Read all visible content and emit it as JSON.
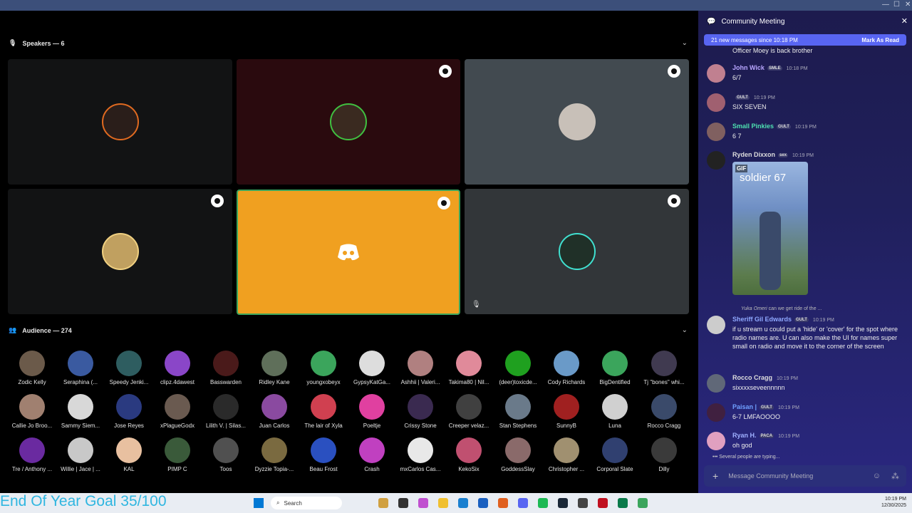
{
  "stage": {
    "speakers_label": "Speakers — 6",
    "audience_label": "Audience — 274"
  },
  "audience": [
    {
      "name": "Zodic Kelly",
      "color": "#6b5a4a"
    },
    {
      "name": "Seraphina (...",
      "color": "#3a5aa0"
    },
    {
      "name": "Speedy Jenki...",
      "color": "#2e5d60"
    },
    {
      "name": "clipz.4dawest",
      "color": "#8a46c8"
    },
    {
      "name": "Basswarden",
      "color": "#4a1a1a"
    },
    {
      "name": "Ridley Kane",
      "color": "#5f6f5a"
    },
    {
      "name": "youngxobeyx",
      "color": "#3ba55c"
    },
    {
      "name": "GypsyKatGa...",
      "color": "#dddddd"
    },
    {
      "name": "Ashhii | Valeri...",
      "color": "#b08080"
    },
    {
      "name": "Takima80 | Nil...",
      "color": "#e08a9a"
    },
    {
      "name": "(deer)toxicde...",
      "color": "#1fa01f"
    },
    {
      "name": "Cody Richards",
      "color": "#6a9ac8"
    },
    {
      "name": "BigDentified",
      "color": "#3ba55c"
    },
    {
      "name": "Tj \"bones\" whi...",
      "color": "#403a50"
    },
    {
      "name": "Callie Jo Broo...",
      "color": "#a08070"
    },
    {
      "name": "Sammy Siem...",
      "color": "#d8d8d8"
    },
    {
      "name": "Jose Reyes",
      "color": "#2a3a80"
    },
    {
      "name": "xPlagueGodx",
      "color": "#6a5a50"
    },
    {
      "name": "Lilith V. | Silas...",
      "color": "#2a2a2a"
    },
    {
      "name": "Juan Carlos",
      "color": "#8a4aa0"
    },
    {
      "name": "The lair of Xyla",
      "color": "#d04050"
    },
    {
      "name": "Poeltje",
      "color": "#e040a0"
    },
    {
      "name": "Crissy Stone",
      "color": "#3a2a50"
    },
    {
      "name": "Creeper velaz...",
      "color": "#404040"
    },
    {
      "name": "Stan Stephens",
      "color": "#6a7a8a"
    },
    {
      "name": "SunnyB",
      "color": "#a02020"
    },
    {
      "name": "Luna",
      "color": "#d0d0d0"
    },
    {
      "name": "Rocco Cragg",
      "color": "#3a4a6a"
    },
    {
      "name": "Tre / Anthony ...",
      "color": "#6a2aa0"
    },
    {
      "name": "Willie | Jace | ...",
      "color": "#c8c8c8"
    },
    {
      "name": "KAL",
      "color": "#e8c0a0"
    },
    {
      "name": "PIMP C",
      "color": "#3a5a3a"
    },
    {
      "name": "Toos",
      "color": "#505050"
    },
    {
      "name": "Dyzzie Topia-...",
      "color": "#7a6a40"
    },
    {
      "name": "Beau Frost",
      "color": "#2a50c0"
    },
    {
      "name": "Crash",
      "color": "#c040c0"
    },
    {
      "name": "mxCarlos Cas...",
      "color": "#e8e8e8"
    },
    {
      "name": "KekoSix",
      "color": "#c05070"
    },
    {
      "name": "GoddessSlay",
      "color": "#8a6a6a"
    },
    {
      "name": "Christopher ...",
      "color": "#a09070"
    },
    {
      "name": "Corporal Slate",
      "color": "#304070"
    },
    {
      "name": "Dilly",
      "color": "#3a3a3a"
    }
  ],
  "chat": {
    "title": "Community Meeting",
    "new_messages": "21 new messages since 10:18 PM",
    "mark_read": "Mark As Read",
    "top_text": "Officer Moey is back brother",
    "messages": [
      {
        "user": "John Wick",
        "tag": "SMLE",
        "time": "10:18 PM",
        "text": "6/7",
        "color": "#b9a6ff",
        "av": "#c08090"
      },
      {
        "user": "",
        "tag": "GULT",
        "time": "10:19 PM",
        "text": "SIX SEVEN",
        "color": "#5865f2",
        "av": "#a06070"
      },
      {
        "user": "Small Pinkies",
        "tag": "GULT",
        "time": "10:19 PM",
        "text": "6 7",
        "color": "#4ee0b0",
        "av": "#806060"
      },
      {
        "user": "Ryden Dixxon",
        "tag": "sex",
        "time": "10:19 PM",
        "text": "",
        "color": "#dddddd",
        "av": "#222222"
      },
      {
        "user": "Sheriff Gil Edwards",
        "tag": "GULT",
        "time": "10:19 PM",
        "text": "if u stream u could put a 'hide' or 'cover' for the spot where radio names are. U can also make the UI for names super small on radio and move it to the corner of the screen",
        "color": "#8fa8ff",
        "av": "#cccccc"
      },
      {
        "user": "Rocco Cragg",
        "tag": "",
        "time": "10:19 PM",
        "text": "sixxxxseveennnnn",
        "color": "#dddddd",
        "av": "#606878"
      },
      {
        "user": "Paisan |",
        "tag": "GULT",
        "time": "10:19 PM",
        "text": "6-7 LMFAOOOO",
        "color": "#6fa0ff",
        "av": "#402040"
      },
      {
        "user": "Ryan H.",
        "tag": "PACA",
        "time": "10:19 PM",
        "text": "oh god",
        "color": "#9fb0ff",
        "av": "#e0a0c0"
      }
    ],
    "gif_label": "GIF",
    "gif_caption": "soldier 67",
    "reply_preview": "Yuka Omeri",
    "reply_text": "can we get ride of the ...",
    "typing": "Several people are typing...",
    "input_placeholder": "Message Community Meeting"
  },
  "taskbar": {
    "goal": "End Of Year Goal 35/100",
    "search": "Search",
    "time": "10:19 PM",
    "date": "12/30/2025"
  }
}
